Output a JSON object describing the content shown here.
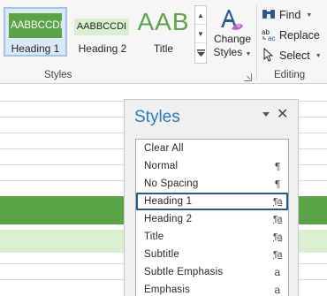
{
  "ribbon": {
    "styles_gallery": [
      {
        "preview": "AABBCCDI",
        "label": "Heading 1",
        "selected": true
      },
      {
        "preview": "AABBCCDI",
        "label": "Heading 2"
      },
      {
        "preview": "AAB",
        "label": "Title"
      }
    ],
    "change_styles": {
      "line1": "Change",
      "line2": "Styles"
    },
    "styles_group_label": "Styles",
    "editing": {
      "find": "Find",
      "replace": "Replace",
      "select": "Select",
      "group_label": "Editing"
    }
  },
  "styles_pane": {
    "title": "Styles",
    "items": [
      {
        "name": "Clear All",
        "indicator": ""
      },
      {
        "name": "Normal",
        "indicator": "¶"
      },
      {
        "name": "No Spacing",
        "indicator": "¶"
      },
      {
        "name": "Heading 1",
        "indicator": "¶a",
        "selected": true
      },
      {
        "name": "Heading 2",
        "indicator": "¶a"
      },
      {
        "name": "Title",
        "indicator": "¶a"
      },
      {
        "name": "Subtitle",
        "indicator": "¶a"
      },
      {
        "name": "Subtle Emphasis",
        "indicator": "a"
      },
      {
        "name": "Emphasis",
        "indicator": "a"
      }
    ]
  },
  "colors": {
    "accent_blue": "#2b79c2",
    "heading_green": "#5aa447",
    "light_green": "#d9efd0",
    "selection_border": "#2b579a"
  }
}
